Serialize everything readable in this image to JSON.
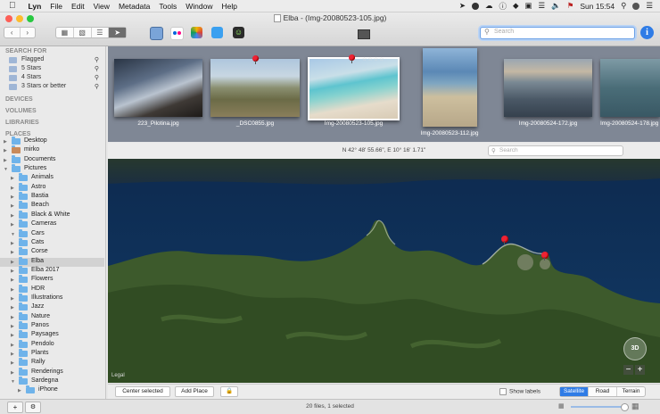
{
  "menubar": {
    "app": "Lyn",
    "items": [
      "File",
      "Edit",
      "View",
      "Metadata",
      "Tools",
      "Window",
      "Help"
    ],
    "clock": "Sun 15:54"
  },
  "window": {
    "title": "Elba - (Img-20080523-105.jpg)",
    "search_placeholder": "Search"
  },
  "sidebar": {
    "search_header": "SEARCH FOR",
    "searches": [
      "Flagged",
      "5 Stars",
      "4 Stars",
      "3 Stars or better"
    ],
    "devices": "DEVICES",
    "volumes": "VOLUMES",
    "libraries": "LIBRARIES",
    "places": "PLACES",
    "tree": [
      {
        "label": "Desktop",
        "level": 0
      },
      {
        "label": "mirko",
        "level": 0
      },
      {
        "label": "Documents",
        "level": 0
      },
      {
        "label": "Pictures",
        "level": 0
      },
      {
        "label": "Animals",
        "level": 1
      },
      {
        "label": "Astro",
        "level": 1
      },
      {
        "label": "Bastia",
        "level": 1
      },
      {
        "label": "Beach",
        "level": 1
      },
      {
        "label": "Black & White",
        "level": 1
      },
      {
        "label": "Cameras",
        "level": 1
      },
      {
        "label": "Cars",
        "level": 1
      },
      {
        "label": "Cats",
        "level": 1
      },
      {
        "label": "Corse",
        "level": 1
      },
      {
        "label": "Elba",
        "level": 1,
        "selected": true
      },
      {
        "label": "Elba 2017",
        "level": 1
      },
      {
        "label": "Flowers",
        "level": 1
      },
      {
        "label": "HDR",
        "level": 1
      },
      {
        "label": "Illustrations",
        "level": 1
      },
      {
        "label": "Jazz",
        "level": 1
      },
      {
        "label": "Nature",
        "level": 1
      },
      {
        "label": "Panos",
        "level": 1
      },
      {
        "label": "Paysages",
        "level": 1
      },
      {
        "label": "Pendolo",
        "level": 1
      },
      {
        "label": "Plants",
        "level": 1
      },
      {
        "label": "Rally",
        "level": 1
      },
      {
        "label": "Renderings",
        "level": 1
      },
      {
        "label": "Sardegna",
        "level": 1
      },
      {
        "label": "iPhone",
        "level": 2
      }
    ]
  },
  "filmstrip": {
    "items": [
      {
        "name": "223_Pilotina.jpg"
      },
      {
        "name": "_DSC0855.jpg"
      },
      {
        "name": "Img-20080523-105.jpg"
      },
      {
        "name": "Img-20080523-112.jpg"
      },
      {
        "name": "Img-20080524-172.jpg"
      },
      {
        "name": "Img-20080524-178.jpg"
      }
    ]
  },
  "map": {
    "coordinates": "N 42° 48' 55.66\", E 10° 16' 1.71\"",
    "search_placeholder": "Search",
    "legal": "Legal",
    "mode_3d": "3D",
    "zoom_out": "−",
    "zoom_in": "+",
    "center_selected": "Center selected",
    "add_place": "Add Place",
    "show_labels": "Show labels",
    "types": [
      "Satellite",
      "Road",
      "Terrain"
    ]
  },
  "status": {
    "text": "20 files, 1 selected"
  },
  "colors": {
    "accent": "#2f7ce6",
    "sea": "#0e2b52",
    "land": "#3d5a2c",
    "pin": "#e22233"
  }
}
